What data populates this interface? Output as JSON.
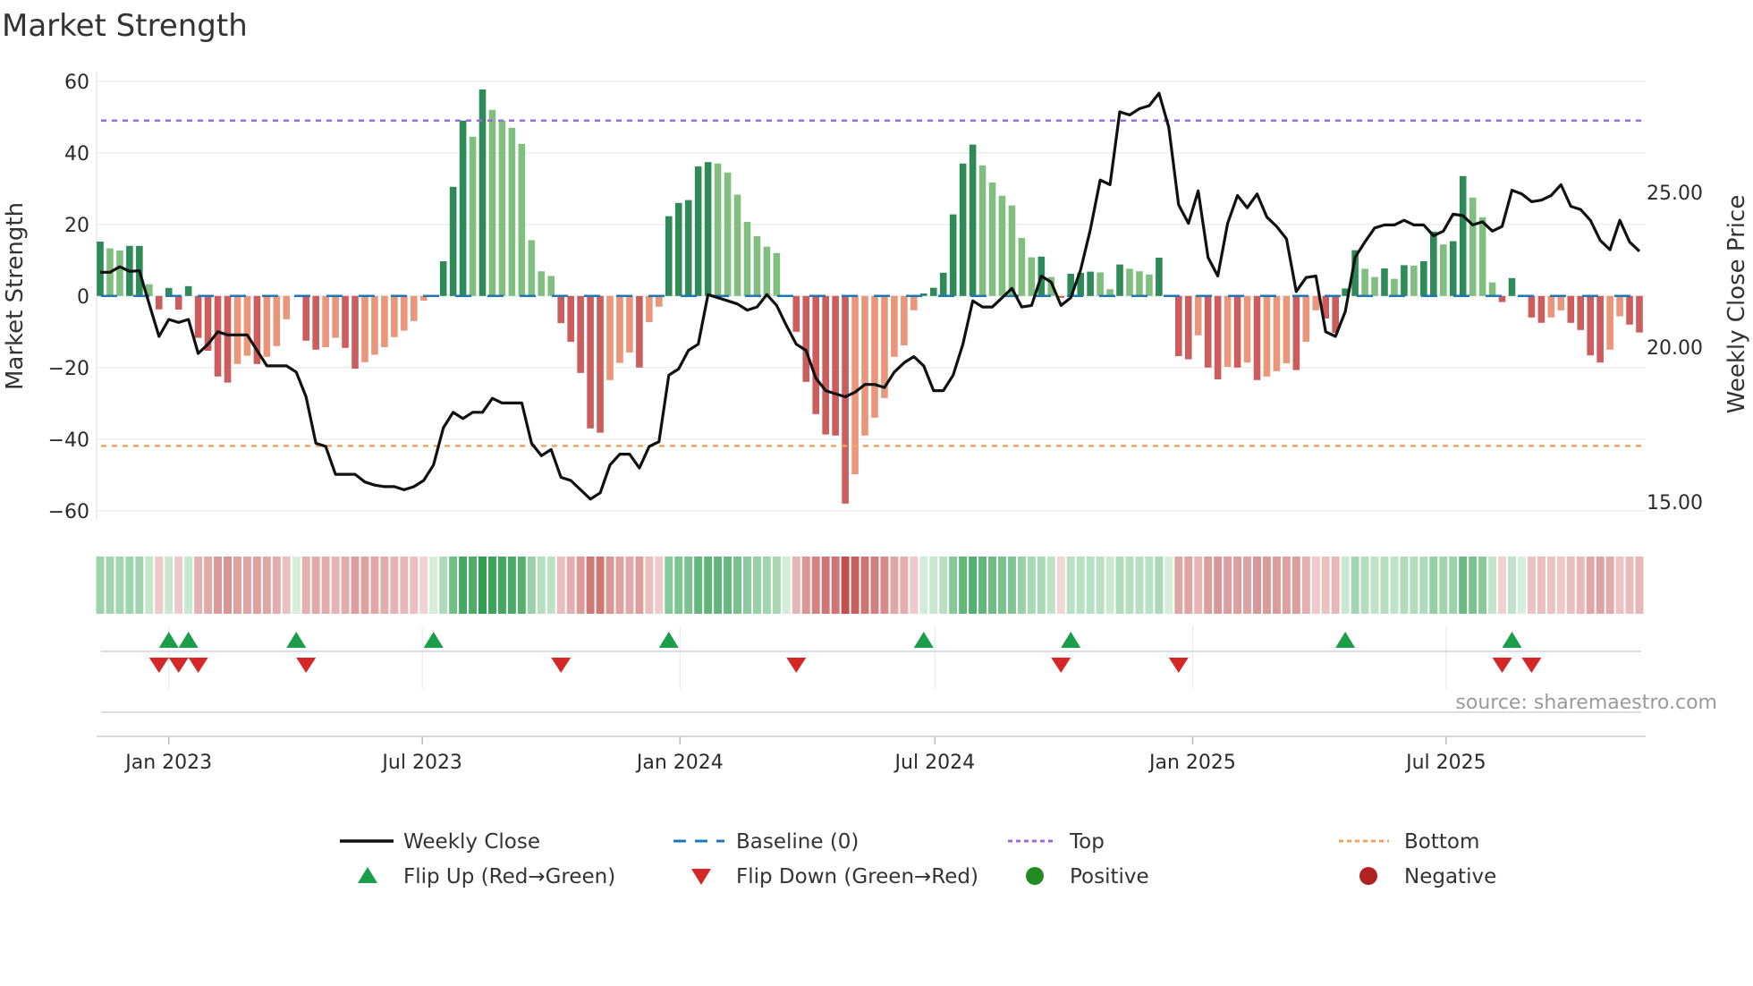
{
  "title": "Market Strength",
  "source": "source: sharemaestro.com",
  "colors": {
    "bar_pos_rising": "#2e8b57",
    "bar_pos_falling": "#80bf80",
    "bar_neg_falling": "#cd5c5c",
    "bar_neg_rising": "#e9967a",
    "close_line": "#111111",
    "baseline": "#1f77b4",
    "top": "#9b6bdc",
    "bottom": "#f4a460",
    "flip_up": "#1a9e4a",
    "flip_down": "#d62728",
    "positive": "#228b22",
    "negative": "#b22222"
  },
  "legend": {
    "weekly_close": "Weekly Close",
    "baseline": "Baseline (0)",
    "top": "Top",
    "bottom": "Bottom",
    "flip_up": "Flip Up (Red→Green)",
    "flip_down": "Flip Down (Green→Red)",
    "positive": "Positive",
    "negative": "Negative"
  },
  "chart_data": {
    "type": "bar",
    "title": "Market Strength",
    "ylabel": "Market Strength",
    "y2label": "Weekly Close Price",
    "ylim": [
      -62.8,
      62.7
    ],
    "y2lim": [
      14.4,
      28.9
    ],
    "yticks": [
      {
        "v": 60,
        "label": "60"
      },
      {
        "v": 40,
        "label": "40"
      },
      {
        "v": 20,
        "label": "20"
      },
      {
        "v": 0,
        "label": "0"
      },
      {
        "v": -20,
        "label": "−20"
      },
      {
        "v": -40,
        "label": "−40"
      },
      {
        "v": -60,
        "label": "−60"
      }
    ],
    "y2ticks": [
      {
        "v": 25,
        "label": "25.00"
      },
      {
        "v": 20,
        "label": "20.00"
      },
      {
        "v": 15,
        "label": "15.00"
      }
    ],
    "x_start": "2022-11-13",
    "x_frequency": "weekly",
    "xticks": [
      {
        "date": "2023-01-01",
        "label": "Jan 2023"
      },
      {
        "date": "2023-07-01",
        "label": "Jul 2023"
      },
      {
        "date": "2024-01-01",
        "label": "Jan 2024"
      },
      {
        "date": "2024-07-01",
        "label": "Jul 2024"
      },
      {
        "date": "2025-01-01",
        "label": "Jan 2025"
      },
      {
        "date": "2025-07-01",
        "label": "Jul 2025"
      }
    ],
    "top_level": 49,
    "bottom_level": -41.9,
    "baseline": 0,
    "legend_position": "bottom",
    "strength": [
      15.2,
      13.3,
      12.7,
      14,
      14,
      3.3,
      -3.75,
      2.25,
      -3.8,
      2.75,
      -11.7,
      -15.3,
      -22.5,
      -24.2,
      -19,
      -16.7,
      -19,
      -17,
      -14,
      -6.5,
      0,
      -12.5,
      -15,
      -14.3,
      -11.7,
      -14.5,
      -20.3,
      -18.5,
      -16.4,
      -14.3,
      -11.5,
      -9.7,
      -7,
      -1.3,
      0,
      9.7,
      30.5,
      49,
      44.5,
      57.7,
      52,
      49,
      47,
      42.5,
      15.6,
      6.9,
      5.6,
      -7.6,
      -12.8,
      -21.5,
      -37,
      -38.2,
      -23.5,
      -18.7,
      -15.8,
      -20,
      -7.3,
      -3,
      22.3,
      26,
      26.8,
      36.2,
      37.4,
      37,
      34.5,
      28.3,
      20.7,
      16.7,
      13.8,
      12,
      0.3,
      -10,
      -24,
      -33,
      -38.7,
      -39,
      -58,
      -49.8,
      -39,
      -34,
      -28.5,
      -17,
      -13.8,
      -4,
      0.7,
      2.3,
      6.5,
      22.8,
      37,
      42.3,
      36.5,
      31.7,
      28,
      25.3,
      16.2,
      10.8,
      11,
      5.3,
      -0.5,
      6.2,
      6.5,
      6.8,
      6.6,
      1.9,
      8.8,
      7.6,
      6.9,
      6,
      10.7,
      0,
      -16.8,
      -17.7,
      -11,
      -20,
      -23.3,
      -19.8,
      -20,
      -18.6,
      -23.5,
      -22.5,
      -21,
      -18.8,
      -20.7,
      -12.8,
      -4,
      -6.3,
      -10.3,
      2.1,
      12.8,
      7.6,
      5.3,
      7.7,
      4.8,
      8.6,
      8.5,
      9.7,
      18,
      14.4,
      15.3,
      33.5,
      27.5,
      22,
      3.8,
      -1.7,
      5,
      0,
      -6,
      -7.5,
      -6,
      -4,
      -7.5,
      -9.5,
      -16.6,
      -18.6,
      -15,
      -5.7,
      -8,
      -10.2
    ],
    "weekly_close": [
      22.42,
      22.42,
      22.6,
      22.45,
      22.47,
      21.4,
      20.35,
      20.9,
      20.8,
      20.9,
      19.8,
      20.1,
      20.5,
      20.4,
      20.4,
      20.4,
      19.9,
      19.4,
      19.4,
      19.4,
      19.2,
      18.4,
      16.9,
      16.8,
      15.9,
      15.9,
      15.9,
      15.65,
      15.55,
      15.5,
      15.5,
      15.4,
      15.5,
      15.7,
      16.2,
      17.4,
      17.9,
      17.7,
      17.9,
      17.9,
      18.35,
      18.2,
      18.2,
      18.2,
      16.9,
      16.5,
      16.7,
      15.8,
      15.7,
      15.4,
      15.1,
      15.3,
      16.2,
      16.55,
      16.55,
      16.1,
      16.8,
      16.95,
      19.1,
      19.3,
      19.9,
      20.1,
      21.7,
      21.6,
      21.5,
      21.4,
      21.2,
      21.3,
      21.7,
      21.35,
      20.7,
      20.1,
      19.9,
      19.0,
      18.6,
      18.5,
      18.4,
      18.55,
      18.8,
      18.8,
      18.7,
      19.2,
      19.5,
      19.7,
      19.4,
      18.6,
      18.6,
      19.1,
      20.1,
      21.5,
      21.3,
      21.3,
      21.6,
      21.9,
      21.3,
      21.35,
      22.3,
      22.1,
      21.35,
      21.6,
      22.5,
      23.8,
      25.4,
      25.25,
      27.6,
      27.5,
      27.7,
      27.8,
      28.2,
      27.1,
      24.6,
      24.0,
      25.05,
      22.9,
      22.3,
      24.0,
      24.9,
      24.5,
      24.95,
      24.2,
      23.9,
      23.5,
      21.8,
      22.25,
      22.3,
      20.5,
      20.35,
      21.15,
      22.9,
      23.4,
      23.85,
      23.95,
      23.95,
      24.1,
      23.95,
      23.95,
      23.6,
      23.75,
      24.3,
      24.25,
      23.95,
      24.05,
      23.75,
      23.9,
      25.07,
      24.95,
      24.7,
      24.75,
      24.9,
      25.25,
      24.55,
      24.45,
      24.1,
      23.45,
      23.15,
      24.1,
      23.4,
      23.1
    ]
  }
}
